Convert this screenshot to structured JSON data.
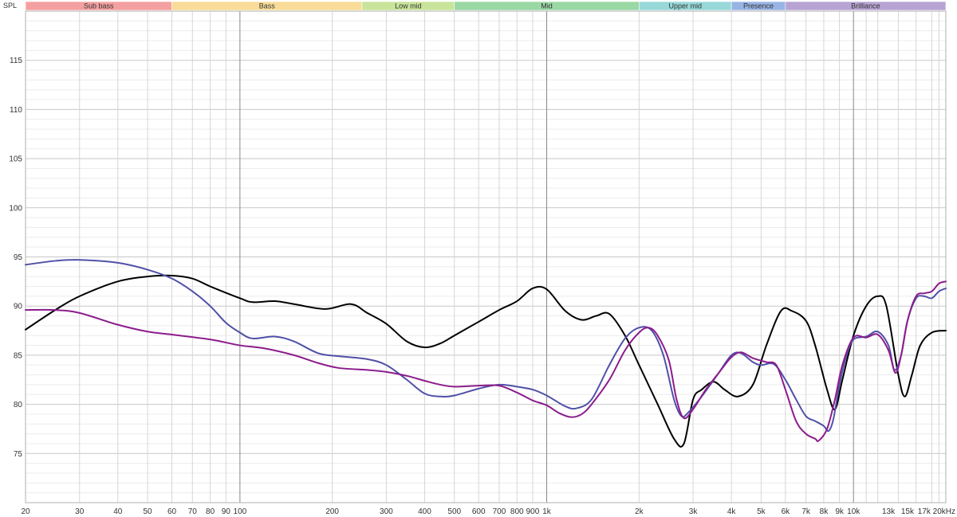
{
  "chart_data": {
    "type": "line",
    "ylabel": "SPL",
    "x_scale": "log",
    "xlim": [
      20,
      20000
    ],
    "ylim": [
      70,
      120
    ],
    "grid": true,
    "x_tick_labels": [
      {
        "v": 20,
        "t": "20"
      },
      {
        "v": 30,
        "t": "30"
      },
      {
        "v": 40,
        "t": "40"
      },
      {
        "v": 50,
        "t": "50"
      },
      {
        "v": 60,
        "t": "60"
      },
      {
        "v": 70,
        "t": "70"
      },
      {
        "v": 80,
        "t": "80"
      },
      {
        "v": 90,
        "t": "90"
      },
      {
        "v": 100,
        "t": "100"
      },
      {
        "v": 200,
        "t": "200"
      },
      {
        "v": 300,
        "t": "300"
      },
      {
        "v": 400,
        "t": "400"
      },
      {
        "v": 500,
        "t": "500"
      },
      {
        "v": 600,
        "t": "600"
      },
      {
        "v": 700,
        "t": "700"
      },
      {
        "v": 800,
        "t": "800"
      },
      {
        "v": 900,
        "t": "900"
      },
      {
        "v": 1000,
        "t": "1k"
      },
      {
        "v": 2000,
        "t": "2k"
      },
      {
        "v": 3000,
        "t": "3k"
      },
      {
        "v": 4000,
        "t": "4k"
      },
      {
        "v": 5000,
        "t": "5k"
      },
      {
        "v": 6000,
        "t": "6k"
      },
      {
        "v": 7000,
        "t": "7k"
      },
      {
        "v": 8000,
        "t": "8k"
      },
      {
        "v": 9000,
        "t": "9k"
      },
      {
        "v": 10000,
        "t": "10k"
      },
      {
        "v": 13000,
        "t": "13k"
      },
      {
        "v": 15000,
        "t": "15k"
      },
      {
        "v": 17000,
        "t": "17k"
      },
      {
        "v": 20000,
        "t": "20kHz"
      }
    ],
    "y_ticks": [
      75,
      80,
      85,
      90,
      95,
      100,
      105,
      110,
      115
    ],
    "bands": [
      {
        "label": "Sub bass",
        "from": 20,
        "to": 60,
        "color": "#f4a0a0"
      },
      {
        "label": "Bass",
        "from": 60,
        "to": 250,
        "color": "#f8dc98"
      },
      {
        "label": "Low mid",
        "from": 250,
        "to": 500,
        "color": "#c8e49a"
      },
      {
        "label": "Mid",
        "from": 500,
        "to": 2000,
        "color": "#9ad8a4"
      },
      {
        "label": "Upper mid",
        "from": 2000,
        "to": 4000,
        "color": "#98d8d8"
      },
      {
        "label": "Presence",
        "from": 4000,
        "to": 6000,
        "color": "#98b4e4"
      },
      {
        "label": "Brilliance",
        "from": 6000,
        "to": 20000,
        "color": "#b8a4d4"
      }
    ],
    "series": [
      {
        "color": "#000000",
        "points": [
          [
            20,
            87.6
          ],
          [
            25,
            89.6
          ],
          [
            30,
            91.0
          ],
          [
            40,
            92.5
          ],
          [
            50,
            93.0
          ],
          [
            60,
            93.1
          ],
          [
            70,
            92.8
          ],
          [
            80,
            92.0
          ],
          [
            100,
            90.8
          ],
          [
            110,
            90.4
          ],
          [
            130,
            90.5
          ],
          [
            150,
            90.2
          ],
          [
            190,
            89.7
          ],
          [
            230,
            90.2
          ],
          [
            260,
            89.3
          ],
          [
            300,
            88.2
          ],
          [
            350,
            86.4
          ],
          [
            400,
            85.8
          ],
          [
            450,
            86.2
          ],
          [
            500,
            87.0
          ],
          [
            600,
            88.4
          ],
          [
            700,
            89.6
          ],
          [
            800,
            90.5
          ],
          [
            900,
            91.8
          ],
          [
            1000,
            91.7
          ],
          [
            1150,
            89.5
          ],
          [
            1300,
            88.6
          ],
          [
            1450,
            89.0
          ],
          [
            1600,
            89.2
          ],
          [
            1800,
            87.0
          ],
          [
            2000,
            84.0
          ],
          [
            2300,
            80.0
          ],
          [
            2600,
            76.5
          ],
          [
            2800,
            76.0
          ],
          [
            3000,
            80.5
          ],
          [
            3200,
            81.5
          ],
          [
            3500,
            82.3
          ],
          [
            3800,
            81.5
          ],
          [
            4200,
            80.8
          ],
          [
            4700,
            82.0
          ],
          [
            5200,
            86.0
          ],
          [
            5800,
            89.5
          ],
          [
            6300,
            89.5
          ],
          [
            7000,
            88.5
          ],
          [
            7500,
            86.0
          ],
          [
            8200,
            81.5
          ],
          [
            8700,
            79.5
          ],
          [
            9200,
            82.5
          ],
          [
            10000,
            87.0
          ],
          [
            11000,
            90.0
          ],
          [
            12000,
            91.0
          ],
          [
            12800,
            90.0
          ],
          [
            14000,
            83.0
          ],
          [
            14700,
            80.8
          ],
          [
            15500,
            83.0
          ],
          [
            16500,
            86.0
          ],
          [
            18000,
            87.3
          ],
          [
            20000,
            87.5
          ]
        ]
      },
      {
        "color": "#5050a8",
        "points": [
          [
            20,
            94.2
          ],
          [
            25,
            94.6
          ],
          [
            30,
            94.7
          ],
          [
            40,
            94.4
          ],
          [
            50,
            93.7
          ],
          [
            60,
            92.8
          ],
          [
            70,
            91.5
          ],
          [
            80,
            90.0
          ],
          [
            90,
            88.3
          ],
          [
            100,
            87.3
          ],
          [
            110,
            86.7
          ],
          [
            130,
            86.9
          ],
          [
            150,
            86.4
          ],
          [
            180,
            85.2
          ],
          [
            210,
            84.9
          ],
          [
            260,
            84.6
          ],
          [
            300,
            84.0
          ],
          [
            350,
            82.5
          ],
          [
            400,
            81.1
          ],
          [
            450,
            80.8
          ],
          [
            500,
            80.9
          ],
          [
            600,
            81.6
          ],
          [
            700,
            82.0
          ],
          [
            800,
            81.8
          ],
          [
            900,
            81.5
          ],
          [
            1000,
            80.9
          ],
          [
            1150,
            79.8
          ],
          [
            1250,
            79.6
          ],
          [
            1400,
            80.5
          ],
          [
            1600,
            84.0
          ],
          [
            1800,
            86.7
          ],
          [
            2000,
            87.8
          ],
          [
            2200,
            87.5
          ],
          [
            2400,
            85.0
          ],
          [
            2600,
            80.5
          ],
          [
            2750,
            78.8
          ],
          [
            2900,
            79.2
          ],
          [
            3200,
            80.8
          ],
          [
            3600,
            83.0
          ],
          [
            4000,
            85.0
          ],
          [
            4300,
            85.2
          ],
          [
            4700,
            84.3
          ],
          [
            5000,
            84.0
          ],
          [
            5500,
            84.1
          ],
          [
            6000,
            82.5
          ],
          [
            6500,
            80.5
          ],
          [
            7000,
            78.8
          ],
          [
            7500,
            78.3
          ],
          [
            8000,
            77.8
          ],
          [
            8300,
            77.3
          ],
          [
            8600,
            78.5
          ],
          [
            9000,
            82.0
          ],
          [
            9500,
            85.0
          ],
          [
            10000,
            86.6
          ],
          [
            11000,
            86.9
          ],
          [
            12000,
            87.4
          ],
          [
            13000,
            86.0
          ],
          [
            13600,
            83.5
          ],
          [
            14300,
            85.0
          ],
          [
            15000,
            88.5
          ],
          [
            16000,
            90.8
          ],
          [
            17000,
            91.0
          ],
          [
            18000,
            90.8
          ],
          [
            19000,
            91.5
          ],
          [
            20000,
            91.8
          ]
        ]
      },
      {
        "color": "#8c1c8c",
        "points": [
          [
            20,
            89.6
          ],
          [
            25,
            89.6
          ],
          [
            30,
            89.3
          ],
          [
            40,
            88.1
          ],
          [
            50,
            87.4
          ],
          [
            60,
            87.1
          ],
          [
            80,
            86.6
          ],
          [
            100,
            86.0
          ],
          [
            120,
            85.7
          ],
          [
            150,
            85.0
          ],
          [
            180,
            84.2
          ],
          [
            210,
            83.7
          ],
          [
            260,
            83.5
          ],
          [
            300,
            83.3
          ],
          [
            350,
            82.9
          ],
          [
            400,
            82.4
          ],
          [
            450,
            82.0
          ],
          [
            500,
            81.8
          ],
          [
            600,
            81.9
          ],
          [
            700,
            81.9
          ],
          [
            800,
            81.2
          ],
          [
            900,
            80.4
          ],
          [
            1000,
            79.9
          ],
          [
            1100,
            79.1
          ],
          [
            1200,
            78.7
          ],
          [
            1300,
            79.0
          ],
          [
            1400,
            80.0
          ],
          [
            1600,
            82.5
          ],
          [
            1800,
            85.5
          ],
          [
            2000,
            87.3
          ],
          [
            2150,
            87.8
          ],
          [
            2300,
            87.0
          ],
          [
            2500,
            84.5
          ],
          [
            2650,
            80.5
          ],
          [
            2800,
            78.6
          ],
          [
            3000,
            79.5
          ],
          [
            3300,
            81.5
          ],
          [
            3700,
            83.5
          ],
          [
            4000,
            84.8
          ],
          [
            4300,
            85.3
          ],
          [
            4700,
            84.7
          ],
          [
            5200,
            84.3
          ],
          [
            5600,
            84.0
          ],
          [
            6000,
            81.5
          ],
          [
            6500,
            78.3
          ],
          [
            7000,
            77.0
          ],
          [
            7500,
            76.5
          ],
          [
            7700,
            76.3
          ],
          [
            8200,
            77.5
          ],
          [
            8700,
            80.5
          ],
          [
            9200,
            84.0
          ],
          [
            10000,
            86.8
          ],
          [
            11000,
            86.8
          ],
          [
            12000,
            87.1
          ],
          [
            13000,
            85.5
          ],
          [
            13700,
            83.2
          ],
          [
            14300,
            85.0
          ],
          [
            15000,
            88.5
          ],
          [
            16000,
            91.0
          ],
          [
            17000,
            91.3
          ],
          [
            18000,
            91.5
          ],
          [
            19000,
            92.3
          ],
          [
            20000,
            92.5
          ]
        ]
      }
    ]
  }
}
